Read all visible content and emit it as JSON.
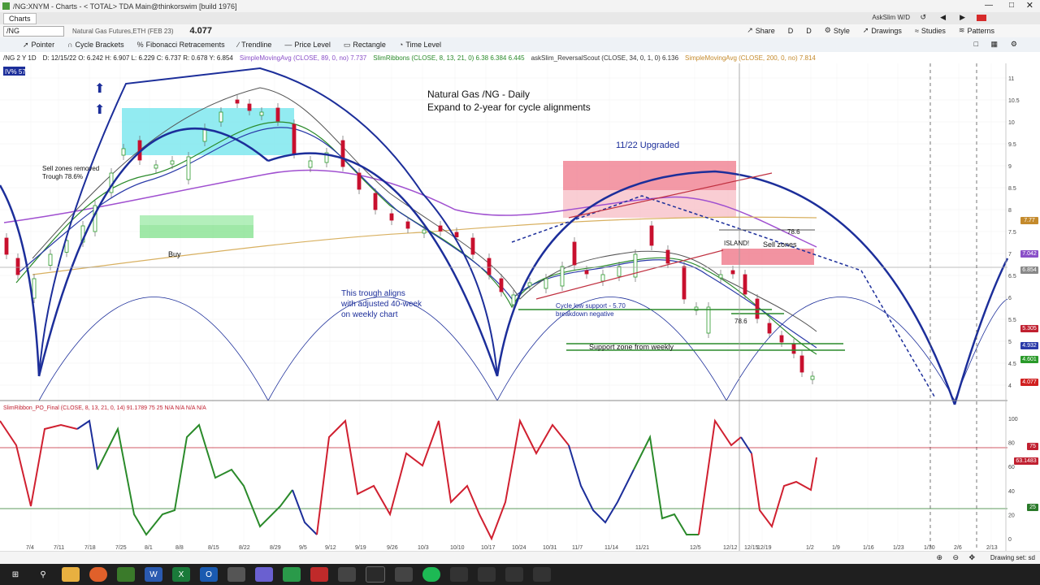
{
  "window": {
    "title": "/NG:XNYM - Charts - < TOTAL> TDA Main@thinkorswim [build 1976]",
    "tab": "Charts",
    "user": "AskSlim W/D"
  },
  "toolbar1": {
    "symbol": "/NG",
    "instrument": "Natural Gas Futures,ETH (FEB 23)",
    "price": "4.077",
    "share": "Share",
    "d1": "D",
    "d2": "D",
    "style": "Style",
    "drawings": "Drawings",
    "studies": "Studies",
    "patterns": "Patterns"
  },
  "toolbar2": {
    "tools": [
      "Pointer",
      "Cycle Brackets",
      "Fibonacci Retracements",
      "Trendline",
      "Price Level",
      "Rectangle",
      "Time Level"
    ]
  },
  "studybar": {
    "quote": "/NG 2 Y 1D",
    "ohlc": "D: 12/15/22  O: 6.242  H: 6.907  L: 6.229  C: 6.737  R: 0.678  Y: 6.854",
    "sma89": "SimpleMovingAvg (CLOSE, 89, 0, no)  7.737",
    "ribbons": "SlimRibbons (CLOSE, 8, 13, 21, 0)  6.38  6.384  6.445",
    "scout": "askSlim_ReversalScout (CLOSE, 34, 0, 1, 0)  6.136",
    "sma200": "SimpleMovingAvg (CLOSE, 200, 0, no)  7.814",
    "iv": "IV% 57"
  },
  "annotations": {
    "title1": "Natural Gas /NG - Daily",
    "title2": "Expand to 2-year for cycle alignments",
    "upgraded": "11/22 Upgraded",
    "sell_removed1": "Sell zones removed",
    "sell_removed2": "Trough 78.6%",
    "buy": "Buy",
    "trough1": "This trough aligns",
    "trough2": "with adjusted 40-week",
    "trough3": "on weekly chart",
    "cycle_low1": "Cycle low support - 5.70",
    "cycle_low2": "breakdown negative",
    "support": "Support zone from weekly",
    "island": "ISLAND!",
    "sell_zones": "Sell zones",
    "fib_a": "78.6",
    "fib_b": "78.6"
  },
  "lower": {
    "study": "SlimRibbon_PO_Final (CLOSE, 8, 13, 21, 0, 14)  91.1789  75  25  N/A  N/A  N/A  N/A"
  },
  "price_axis": [
    "11",
    "10.5",
    "10",
    "9.5",
    "9",
    "8.5",
    "8",
    "7.5",
    "7",
    "6.5",
    "6",
    "5.5",
    "5",
    "4.5",
    "4"
  ],
  "price_tags": [
    {
      "label": "7.77",
      "color": "#c48a2c"
    },
    {
      "label": "7.042",
      "color": "#8a4fc8"
    },
    {
      "label": "6.854",
      "color": "#888888"
    },
    {
      "label": "5.305",
      "color": "#c02030"
    },
    {
      "label": "4.932",
      "color": "#2a3aa8"
    },
    {
      "label": "4.601",
      "color": "#2a9a2a"
    },
    {
      "label": "4.077",
      "color": "#d02020"
    }
  ],
  "osc_axis": [
    "100",
    "80",
    "60",
    "40",
    "20",
    "0"
  ],
  "osc_tags": [
    {
      "label": "75",
      "color": "#c02030"
    },
    {
      "label": "63.1483",
      "color": "#c02030"
    },
    {
      "label": "25",
      "color": "#2a7a2a"
    }
  ],
  "x_axis": [
    "7/4",
    "7/11",
    "7/18",
    "7/25",
    "8/1",
    "8/8",
    "8/15",
    "8/22",
    "8/29",
    "9/5",
    "9/12",
    "9/19",
    "9/26",
    "10/3",
    "10/10",
    "10/17",
    "10/24",
    "10/31",
    "11/7",
    "11/14",
    "11/21",
    "12/5",
    "12/12",
    "12/15",
    "12/19",
    "1/2",
    "1/9",
    "1/16",
    "1/23",
    "1/30",
    "2/6",
    "2/13"
  ],
  "status": {
    "drawing_set": "Drawing set: sd"
  }
}
